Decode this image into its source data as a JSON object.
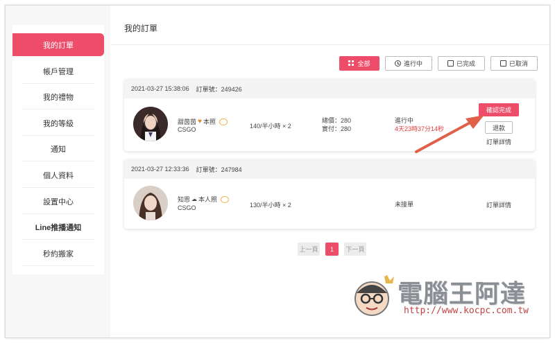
{
  "sidebar": {
    "items": [
      {
        "label": "我的訂單",
        "active": true
      },
      {
        "label": "帳戶管理"
      },
      {
        "label": "我的禮物"
      },
      {
        "label": "我的等級"
      },
      {
        "label": "通知"
      },
      {
        "label": "個人資料"
      },
      {
        "label": "設置中心"
      },
      {
        "label": "Line推播通知"
      },
      {
        "label": "秒約搬家"
      }
    ]
  },
  "main": {
    "title": "我的訂單",
    "filters": [
      {
        "label": "全部",
        "icon": "grid-icon",
        "active": true
      },
      {
        "label": "進行中",
        "icon": "clock-icon"
      },
      {
        "label": "已完成",
        "icon": "document-icon"
      },
      {
        "label": "已取消",
        "icon": "document-icon"
      }
    ]
  },
  "orders": [
    {
      "datetime": "2021-03-27 15:38:06",
      "order_no": "訂單號：249426",
      "nickname": "甜茵茵",
      "nickname_suffix": "本照",
      "game": "CSGO",
      "price": "140/半小時 × 2",
      "total": "總價：280",
      "paid": "實付：280",
      "status": "進行中",
      "timer": "4天23時37分14秒",
      "confirm_label": "確認完成",
      "refund_label": "退款",
      "detail_label": "訂單詳情"
    },
    {
      "datetime": "2021-03-27 12:33:36",
      "order_no": "訂單號：247984",
      "nickname": "知恩",
      "nickname_suffix": "本人照",
      "game": "CSGO",
      "price": "130/半小時 × 2",
      "status": "未接單",
      "detail_label": "訂單詳情"
    }
  ],
  "pagination": {
    "prev": "上一頁",
    "current": "1",
    "next": "下一頁"
  },
  "watermark": {
    "text": "電腦王阿達",
    "url": "http://www.kocpc.com.tw"
  },
  "colors": {
    "accent": "#ee4d6a",
    "timer": "#e03a3a",
    "arrow": "#e0604a"
  }
}
